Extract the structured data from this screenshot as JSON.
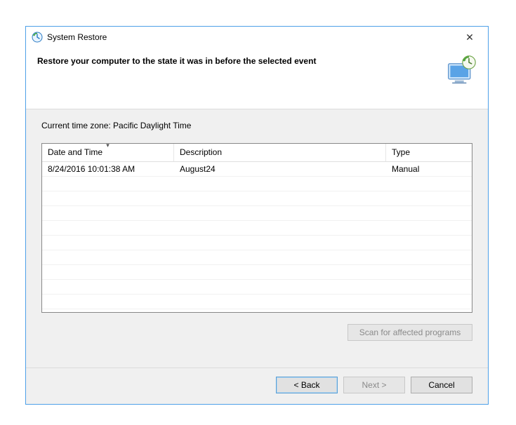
{
  "window": {
    "title": "System Restore"
  },
  "header": {
    "heading": "Restore your computer to the state it was in before the selected event"
  },
  "body": {
    "timezone_label": "Current time zone: Pacific Daylight Time"
  },
  "table": {
    "columns": {
      "date_time": "Date and Time",
      "description": "Description",
      "type": "Type"
    },
    "rows": [
      {
        "date_time": "8/24/2016 10:01:38 AM",
        "description": "August24",
        "type": "Manual"
      }
    ]
  },
  "buttons": {
    "scan": "Scan for affected programs",
    "back": "< Back",
    "next": "Next >",
    "cancel": "Cancel"
  }
}
